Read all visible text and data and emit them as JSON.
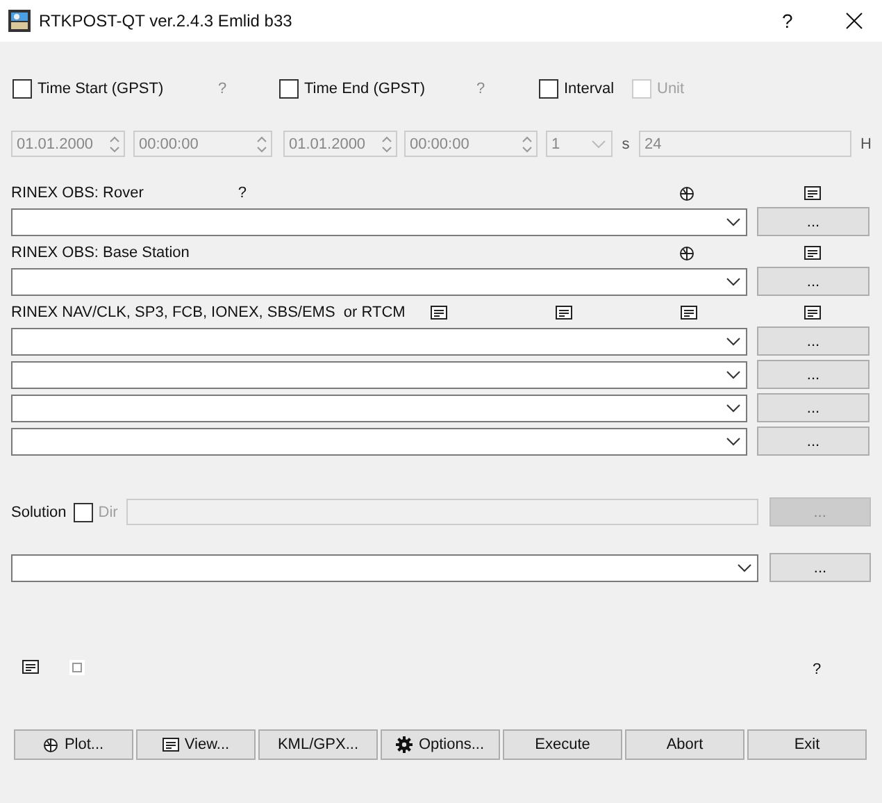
{
  "window": {
    "title": "RTKPOST-QT ver.2.4.3 Emlid b33",
    "help": "?"
  },
  "time_start": {
    "label": "Time Start (GPST)",
    "checked": false,
    "help": "?",
    "date": "01.01.2000",
    "time": "00:00:00"
  },
  "time_end": {
    "label": "Time End (GPST)",
    "checked": false,
    "help": "?",
    "date": "01.01.2000",
    "time": "00:00:00"
  },
  "interval": {
    "label": "Interval",
    "checked": false,
    "value": "1",
    "unit": "s"
  },
  "unit": {
    "label": "Unit",
    "checked": false,
    "disabled": true,
    "value": "24",
    "unit": "H"
  },
  "rover": {
    "label": "RINEX OBS: Rover",
    "help": "?",
    "button": "..."
  },
  "base": {
    "label": "RINEX OBS: Base Station",
    "button": "..."
  },
  "nav": {
    "label": "RINEX NAV/CLK, SP3, FCB, IONEX, SBS/EMS  or RTCM",
    "files": [
      {
        "button": "..."
      },
      {
        "button": "..."
      },
      {
        "button": "..."
      },
      {
        "button": "..."
      }
    ]
  },
  "solution": {
    "label": "Solution",
    "dir": {
      "label": "Dir",
      "checked": false,
      "disabled": true
    },
    "dir_button": "...",
    "output_button": "..."
  },
  "footer": {
    "help": "?"
  },
  "buttons": [
    {
      "label": "Plot...",
      "kind": "plot"
    },
    {
      "label": "View...",
      "kind": "view"
    },
    {
      "label": "KML/GPX...",
      "kind": "plain"
    },
    {
      "label": "Options...",
      "kind": "options"
    },
    {
      "label": "Execute",
      "kind": "plain"
    },
    {
      "label": "Abort",
      "kind": "plain"
    },
    {
      "label": "Exit",
      "kind": "plain"
    }
  ]
}
